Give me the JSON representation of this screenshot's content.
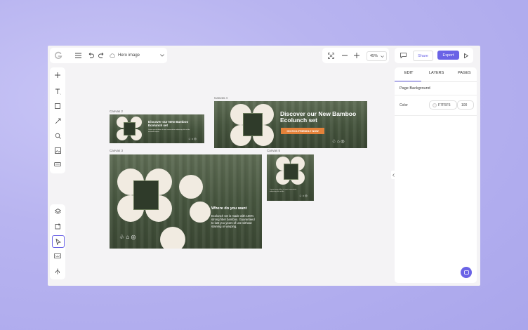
{
  "toolbar": {
    "document_name": "Hero image",
    "zoom_label": "45%",
    "share_label": "Share",
    "export_label": "Export"
  },
  "right_panel": {
    "tabs": [
      {
        "label": "EDIT"
      },
      {
        "label": "LAYERS"
      },
      {
        "label": "PAGES"
      }
    ],
    "section_title": "Page Background",
    "color_label": "Color",
    "color_hex": "F7F5F5",
    "color_opacity": "100"
  },
  "colors": {
    "accent": "#6a63e6",
    "page_background": "#f4f3f5",
    "cta": "#e4823a"
  },
  "canvases": [
    {
      "label": "Canvas 2",
      "headline": "Discover our New Bamboo Ecolunch set",
      "subtext": "Lorem ipsum dolor sit amet consectetur adipiscing elit sed do eiusmod tempor"
    },
    {
      "label": "Canvas 4",
      "headline": "Discover our New Bamboo Ecolunch set",
      "cta": "GO ECO-FRIENDLY NOW"
    },
    {
      "label": "Canvas 3",
      "headline": "Where do you want",
      "subtext": "Ecolunch set is made with 100% strong fiber bamboo. Guaranteed to last you years of use without staining or warping."
    },
    {
      "label": "Canvas 5",
      "subtext": "Lorem ipsum dolor sit amet consectetur adipiscing elit sed do"
    }
  ],
  "icons": {
    "left_toolbar_top": [
      "plus-icon",
      "text-icon",
      "shape-icon",
      "pen-icon",
      "search-image-icon",
      "image-icon",
      "component-icon"
    ],
    "left_toolbar_bottom": [
      "layers-icon",
      "crop-icon",
      "select-icon",
      "keyboard-icon",
      "tree-icon"
    ]
  }
}
